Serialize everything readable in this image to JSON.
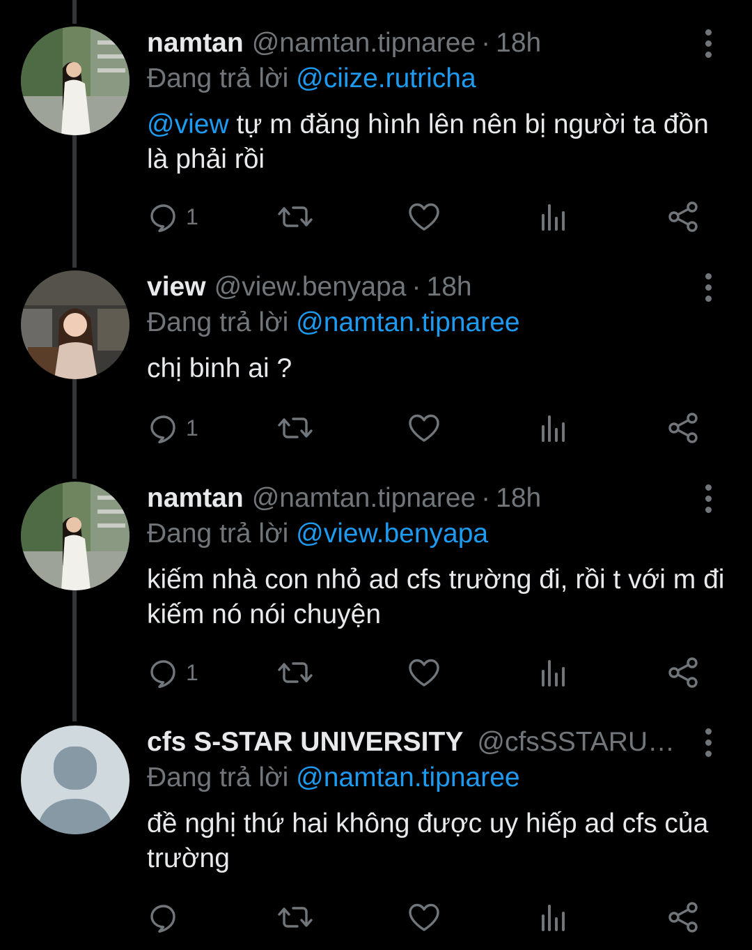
{
  "tweets": [
    {
      "name": "namtan",
      "handle": "@namtan.tipnaree",
      "time": "18h",
      "replying_prefix": "Đang trả lời",
      "replying_to": "@ciize.rutricha",
      "text_mention": "@view",
      "text": " tự m đăng hình lên nên bị người ta đồn là phải rồi",
      "reply_count": "1",
      "avatar": "photo-woman-white-dress"
    },
    {
      "name": "view",
      "handle": "@view.benyapa",
      "time": "18h",
      "replying_prefix": "Đang trả lời",
      "replying_to": "@namtan.tipnaree",
      "text_mention": "",
      "text": "chị binh ai ?",
      "reply_count": "1",
      "avatar": "photo-woman-cafe"
    },
    {
      "name": "namtan",
      "handle": "@namtan.tipnaree",
      "time": "18h",
      "replying_prefix": "Đang trả lời",
      "replying_to": "@view.benyapa",
      "text_mention": "",
      "text": "kiếm nhà con nhỏ ad cfs trường đi, rồi t với m đi kiếm nó nói chuyện",
      "reply_count": "1",
      "avatar": "photo-woman-white-dress"
    },
    {
      "name": "cfs S-STAR UNIVERSITY",
      "handle": "@cfsSSTARUNIVERSITY",
      "time": "",
      "replying_prefix": "Đang trả lời",
      "replying_to": "@namtan.tipnaree",
      "text_mention": "",
      "text": "đề nghị thứ hai không được uy hiếp ad cfs của trường",
      "reply_count": "",
      "avatar": "default-user-icon"
    }
  ],
  "icons": {
    "reply": "comment-icon",
    "retweet": "retweet-icon",
    "like": "heart-icon",
    "views": "analytics-icon",
    "share": "share-icon",
    "more": "more-vertical-icon"
  },
  "colors": {
    "background": "#000000",
    "text": "#e7e9ea",
    "muted": "#71767b",
    "link": "#1d9bf0",
    "thread_line": "#333639"
  }
}
